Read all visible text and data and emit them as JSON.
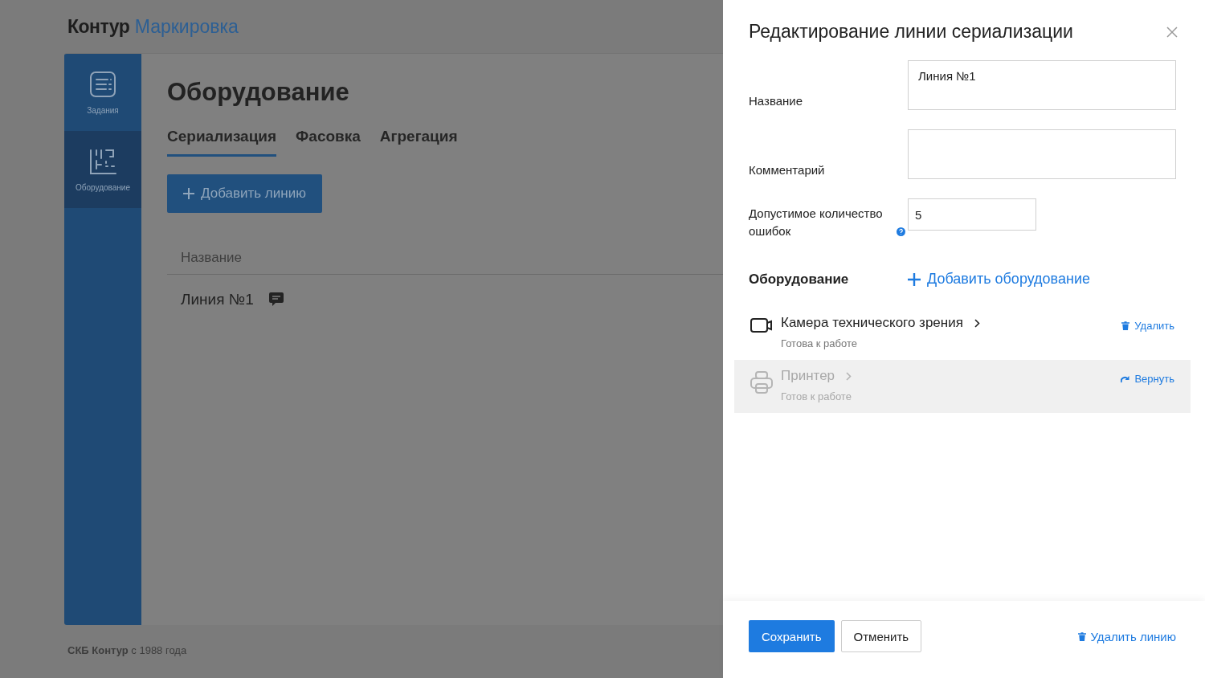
{
  "header": {
    "brand": "Контур",
    "product": "Маркировка"
  },
  "sidebar": {
    "items": [
      {
        "label": "Задания",
        "kind": "tasks",
        "selected": false
      },
      {
        "label": "Оборудование",
        "kind": "equipment",
        "selected": true
      }
    ]
  },
  "page": {
    "title": "Оборудование",
    "tabs": [
      {
        "label": "Сериализация",
        "selected": true
      },
      {
        "label": "Фасовка",
        "selected": false
      },
      {
        "label": "Агрегация",
        "selected": false
      }
    ],
    "add_button": "Добавить линию",
    "table": {
      "columns": [
        "Название"
      ],
      "rows": [
        {
          "name": "Линия №1",
          "has_comment": true
        }
      ]
    }
  },
  "footer": "**СКБ Контур** с 1988 года",
  "panel": {
    "title": "Редактирование линии сериализации",
    "fields": [
      {
        "label": "Название",
        "value": "Линия №1",
        "kind": "multiline",
        "help": false
      },
      {
        "label": "Комментарий",
        "kind": "multiline",
        "help": false
      },
      {
        "label": "Допустимое количество ошибок",
        "value": "5",
        "kind": "number",
        "help": true
      }
    ],
    "equipment": {
      "title": "Оборудование",
      "add_link": "Добавить оборудование",
      "items": [
        {
          "name": "Камера технического зрения",
          "status": "Готова к работе",
          "kind": "camera",
          "removed": false,
          "action": "Удалить"
        },
        {
          "name": "Принтер",
          "status": "Готов к работе",
          "kind": "printer",
          "removed": true,
          "action": "Вернуть"
        }
      ]
    },
    "buttons": {
      "save": "Сохранить",
      "cancel": "Отменить",
      "delete": "Удалить линию"
    }
  }
}
